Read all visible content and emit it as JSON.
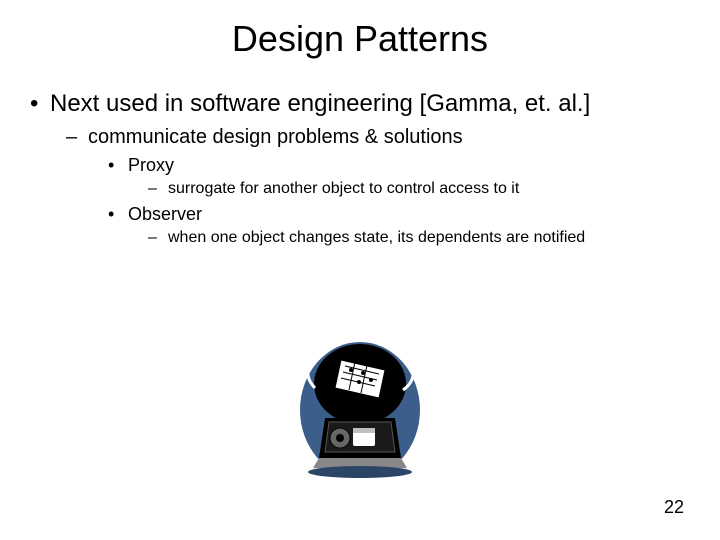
{
  "title": "Design Patterns",
  "bullets": {
    "l1_1": "Next used in software engineering [Gamma, et. al.]",
    "l2_1": "communicate design problems & solutions",
    "l3_1": "Proxy",
    "l4_1": "surrogate for another object to control access to it",
    "l3_2": "Observer",
    "l4_2": "when one object changes state, its dependents are notified"
  },
  "page_number": "22"
}
